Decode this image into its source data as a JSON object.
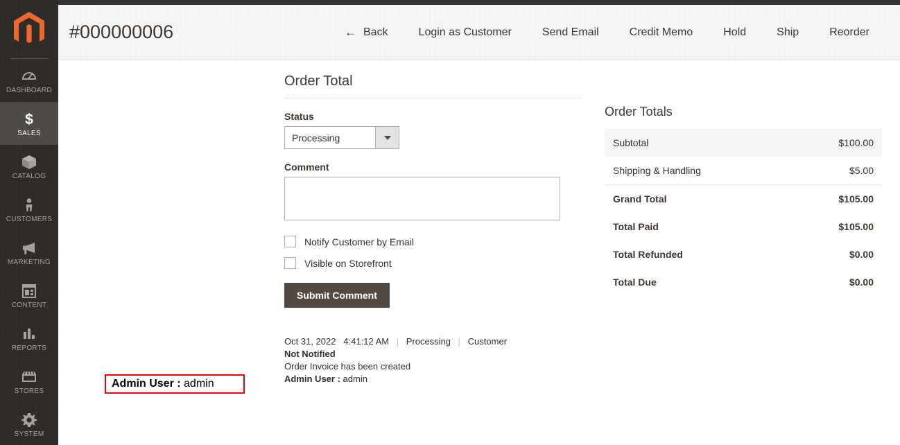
{
  "sidebar": {
    "logo_name": "magento-logo",
    "items": [
      {
        "label": "Dashboard",
        "icon": "dashboard-icon",
        "active": false
      },
      {
        "label": "Sales",
        "icon": "dollar-icon",
        "active": true
      },
      {
        "label": "Catalog",
        "icon": "box-icon",
        "active": false
      },
      {
        "label": "Customers",
        "icon": "person-icon",
        "active": false
      },
      {
        "label": "Marketing",
        "icon": "megaphone-icon",
        "active": false
      },
      {
        "label": "Content",
        "icon": "layout-icon",
        "active": false
      },
      {
        "label": "Reports",
        "icon": "bar-chart-icon",
        "active": false
      },
      {
        "label": "Stores",
        "icon": "storefront-icon",
        "active": false
      },
      {
        "label": "System",
        "icon": "gear-icon",
        "active": false
      }
    ]
  },
  "header": {
    "title": "#000000006",
    "actions": [
      {
        "label": "Back",
        "icon": "arrow-left-icon"
      },
      {
        "label": "Login as Customer",
        "icon": ""
      },
      {
        "label": "Send Email",
        "icon": ""
      },
      {
        "label": "Credit Memo",
        "icon": ""
      },
      {
        "label": "Hold",
        "icon": ""
      },
      {
        "label": "Ship",
        "icon": ""
      },
      {
        "label": "Reorder",
        "icon": ""
      }
    ]
  },
  "order_total": {
    "section_title": "Order Total",
    "status_label": "Status",
    "status_value": "Processing",
    "comment_label": "Comment",
    "comment_value": "",
    "comment_placeholder": "",
    "checkboxes": [
      {
        "label": "Notify Customer by Email",
        "checked": false
      },
      {
        "label": "Visible on Storefront",
        "checked": false
      }
    ],
    "submit_label": "Submit Comment"
  },
  "order_totals": {
    "title": "Order Totals",
    "rows": [
      {
        "label": "Subtotal",
        "amount": "$100.00",
        "bold": false,
        "shaded": true,
        "ruled": false
      },
      {
        "label": "Shipping & Handling",
        "amount": "$5.00",
        "bold": false,
        "shaded": false,
        "ruled": true
      },
      {
        "label": "Grand Total",
        "amount": "$105.00",
        "bold": true,
        "shaded": false,
        "ruled": false
      },
      {
        "label": "Total Paid",
        "amount": "$105.00",
        "bold": true,
        "shaded": false,
        "ruled": false
      },
      {
        "label": "Total Refunded",
        "amount": "$0.00",
        "bold": true,
        "shaded": false,
        "ruled": false
      },
      {
        "label": "Total Due",
        "amount": "$0.00",
        "bold": true,
        "shaded": false,
        "ruled": false
      }
    ]
  },
  "history": {
    "date": "Oct 31, 2022",
    "time": "4:41:12 AM",
    "status": "Processing",
    "notify_prefix": "Customer ",
    "notify_state": "Not Notified",
    "comment": "Order Invoice has been created",
    "admin_label": "Admin User :",
    "admin_value": "admin"
  },
  "colors": {
    "accent": "#ee672e",
    "sidebar_bg": "#2e2b29",
    "sidebar_active": "#4e4a47",
    "button_dark": "#514943",
    "highlight_border": "#ee0000",
    "header_bg": "#f5f5f5"
  }
}
